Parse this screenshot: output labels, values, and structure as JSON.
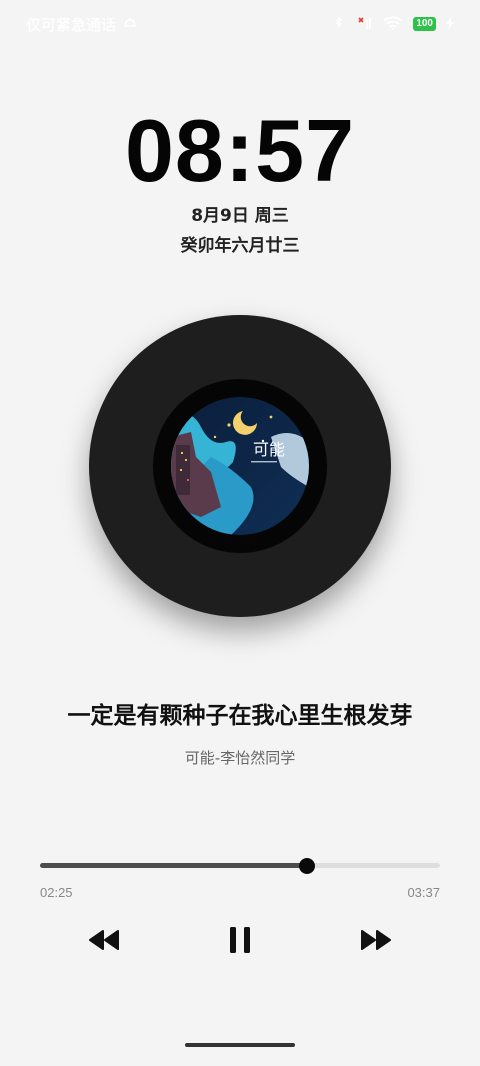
{
  "status_bar": {
    "carrier_text": "仅可紧急通话",
    "battery_level": "100",
    "icons": [
      "nfc-icon",
      "no-sim-icon",
      "wifi-icon",
      "battery-icon",
      "charging-icon"
    ]
  },
  "lockscreen": {
    "time": "08:57",
    "date": "8月9日 周三",
    "lunar_date": "癸卯年六月廿三"
  },
  "player": {
    "lyric": "一定是有颗种子在我心里生根发芽",
    "artist_line": "可能-李怡然同学",
    "elapsed": "02:25",
    "duration": "03:37",
    "progress_fraction": 0.668,
    "state": "playing",
    "controls": [
      "rewind-icon",
      "pause-icon",
      "fast-forward-icon"
    ]
  },
  "colors": {
    "background": "#f4f4f4",
    "vinyl": "#1e1e1e",
    "progress_fill": "#4d4d4d",
    "battery": "#2ec24a"
  }
}
